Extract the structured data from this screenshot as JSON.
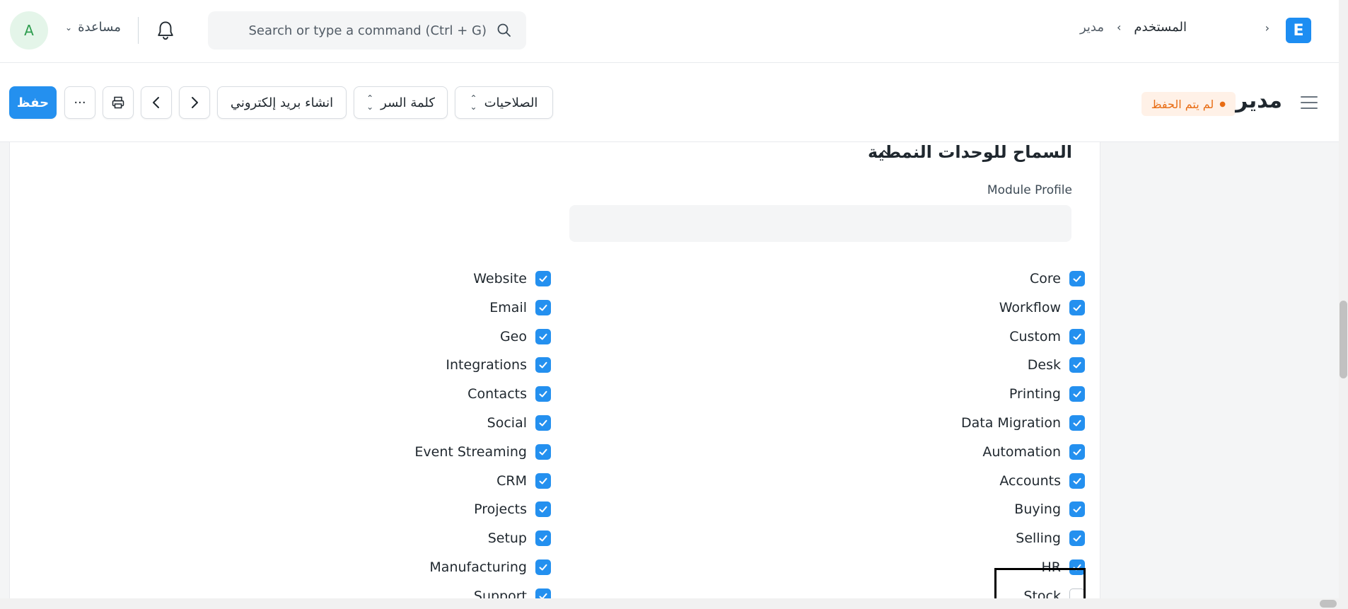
{
  "navbar": {
    "avatar_letter": "A",
    "help_label": "مساعدة",
    "search_placeholder": "Search or type a command (Ctrl + G)",
    "breadcrumb_users": "المستخدم",
    "breadcrumb_current": "مدير"
  },
  "page": {
    "title": "مدير",
    "status_badge": "لم يتم الحفظ",
    "save_label": "حفظ",
    "more_label": "···",
    "email_label": "انشاء بريد إلكتروني",
    "password_label": "كلمة السر",
    "permissions_label": "الصلاحيات"
  },
  "section": {
    "title": "السماح للوحدات النمطية",
    "module_profile_label": "Module Profile",
    "module_profile_value": ""
  },
  "modules_right": [
    {
      "label": "Core",
      "checked": true
    },
    {
      "label": "Workflow",
      "checked": true
    },
    {
      "label": "Custom",
      "checked": true
    },
    {
      "label": "Desk",
      "checked": true
    },
    {
      "label": "Printing",
      "checked": true
    },
    {
      "label": "Data Migration",
      "checked": true
    },
    {
      "label": "Automation",
      "checked": true
    },
    {
      "label": "Accounts",
      "checked": true
    },
    {
      "label": "Buying",
      "checked": true
    },
    {
      "label": "Selling",
      "checked": true
    },
    {
      "label": "HR",
      "checked": true
    },
    {
      "label": "Stock",
      "checked": false
    }
  ],
  "modules_left": [
    {
      "label": "Website",
      "checked": true
    },
    {
      "label": "Email",
      "checked": true
    },
    {
      "label": "Geo",
      "checked": true
    },
    {
      "label": "Integrations",
      "checked": true
    },
    {
      "label": "Contacts",
      "checked": true
    },
    {
      "label": "Social",
      "checked": true
    },
    {
      "label": "Event Streaming",
      "checked": true
    },
    {
      "label": "CRM",
      "checked": true
    },
    {
      "label": "Projects",
      "checked": true
    },
    {
      "label": "Setup",
      "checked": true
    },
    {
      "label": "Manufacturing",
      "checked": true
    },
    {
      "label": "Support",
      "checked": true
    }
  ],
  "colors": {
    "primary": "#2490ef",
    "badge_text": "#e86c13",
    "badge_bg": "#fff1e7"
  }
}
